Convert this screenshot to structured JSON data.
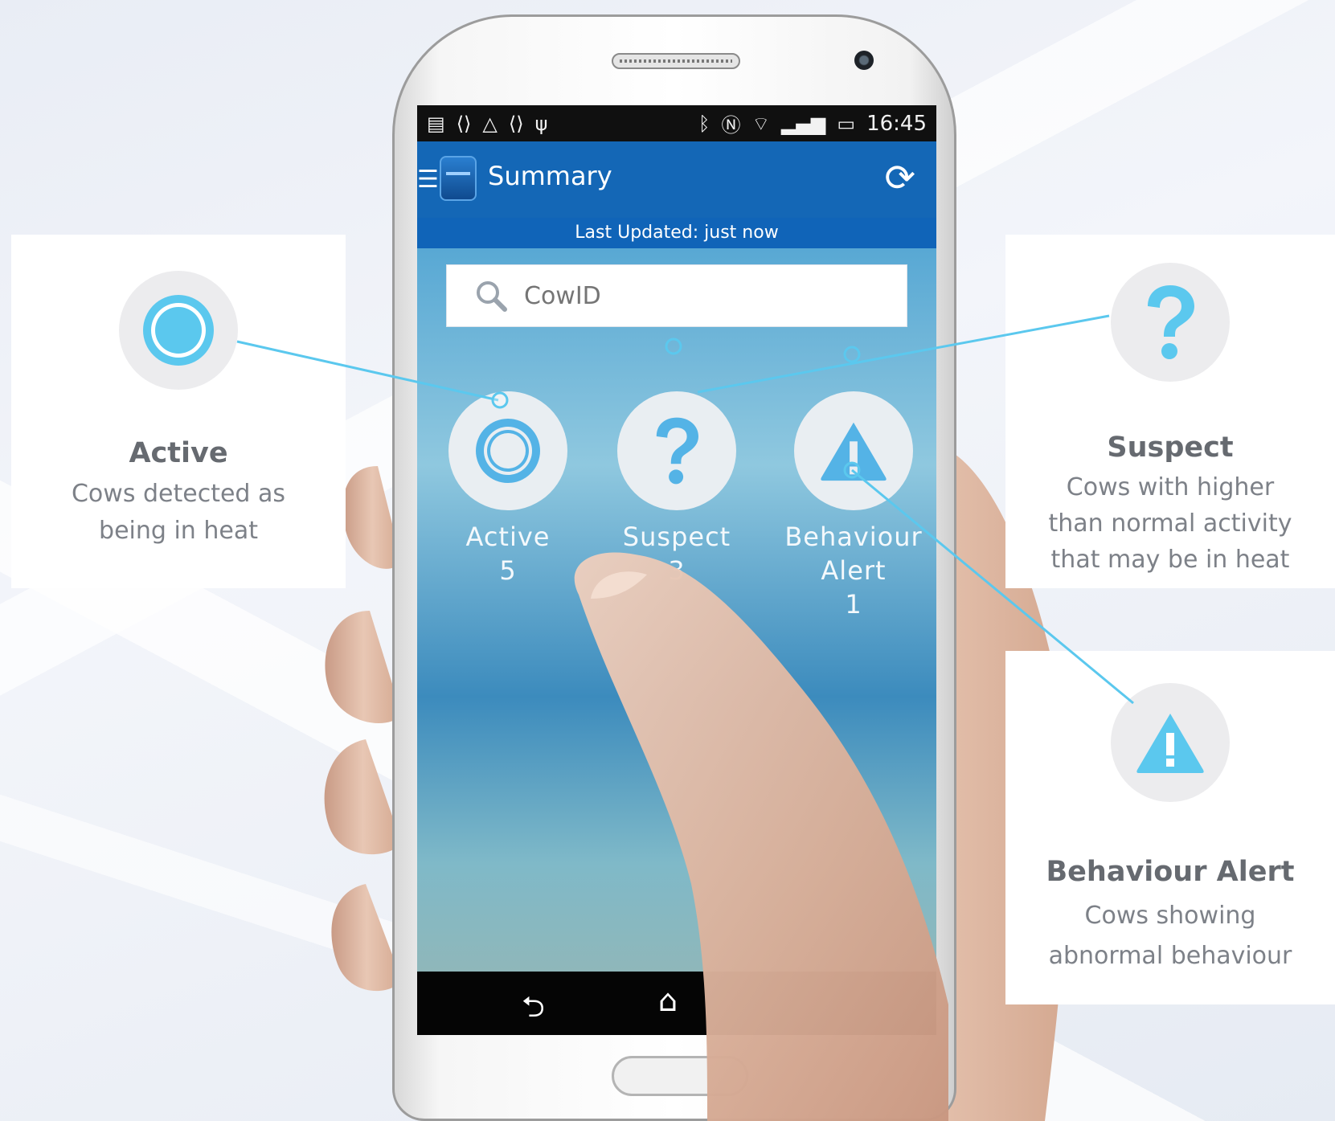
{
  "status_bar": {
    "left_icons": [
      "notification-icon",
      "code-icon",
      "warning-icon",
      "code-icon",
      "usb-icon"
    ],
    "right_icons": [
      "bluetooth-icon",
      "nfc-icon",
      "wifi-icon",
      "signal-icon",
      "battery-icon"
    ],
    "time": "16:45"
  },
  "app_bar": {
    "title": "Summary",
    "refresh_icon": "refresh-icon",
    "menu_icon": "menu-icon"
  },
  "updated": {
    "text": "Last Updated:  just now"
  },
  "search": {
    "placeholder": "CowID",
    "value": ""
  },
  "tiles": [
    {
      "label": "Active",
      "count": "5",
      "icon": "ring-icon"
    },
    {
      "label": "Suspect",
      "count": "3",
      "icon": "question-icon"
    },
    {
      "label_line1": "Behaviour",
      "label_line2": "Alert",
      "count": "1",
      "icon": "warning-triangle-icon"
    }
  ],
  "nav": {
    "back_icon": "back-icon",
    "home_icon": "home-icon"
  },
  "callouts": {
    "active": {
      "title": "Active",
      "desc_line1": "Cows detected as",
      "desc_line2": "being in heat"
    },
    "suspect": {
      "title": "Suspect",
      "desc_line1": "Cows with higher",
      "desc_line2": "than normal activity",
      "desc_line3": "that may be in heat"
    },
    "behaviour": {
      "title": "Behaviour Alert",
      "desc_line1": "Cows showing",
      "desc_line2": "abnormal behaviour"
    }
  },
  "colors": {
    "accent": "#5bc8ee",
    "app_bar": "#1467b6",
    "icon_bubble": "#ececee",
    "tile_icon": "#54b3e6"
  }
}
